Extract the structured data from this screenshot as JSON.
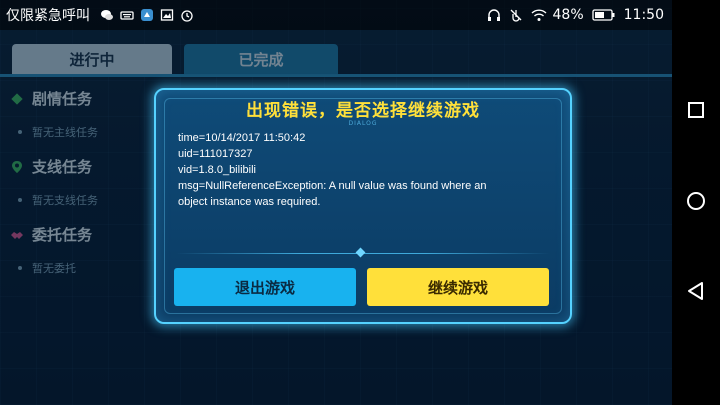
{
  "status_bar": {
    "carrier": "仅限紧急呼叫",
    "battery": "48%",
    "time": "11:50"
  },
  "tabs": [
    {
      "label": "进行中"
    },
    {
      "label": "已完成"
    }
  ],
  "categories": [
    {
      "label": "剧情任务",
      "sub": "暂无主线任务"
    },
    {
      "label": "支线任务",
      "sub": "暂无支线任务"
    },
    {
      "label": "委托任务",
      "sub": "暂无委托"
    }
  ],
  "dialog": {
    "title": "出现错误，是否选择继续游戏",
    "subtitle": "DIALOG",
    "lines": [
      "time=10/14/2017 11:50:42",
      "uid=111017327",
      "vid=1.8.0_bilibili",
      "msg=NullReferenceException: A null value was found where an",
      "object instance was required."
    ],
    "exit_label": "退出游戏",
    "continue_label": "继续游戏"
  },
  "colors": {
    "accent": "#55d2ff",
    "title": "#ffe03a",
    "exit_button": "#18b2ef",
    "continue_button": "#ffe03a"
  },
  "icons": [
    "wechat-icon",
    "keyboard-icon",
    "app-icon",
    "image-icon",
    "alarm-icon",
    "headphones-icon",
    "mute-icon",
    "wifi-icon",
    "battery-icon",
    "square-nav-icon",
    "circle-nav-icon",
    "triangle-nav-icon"
  ]
}
